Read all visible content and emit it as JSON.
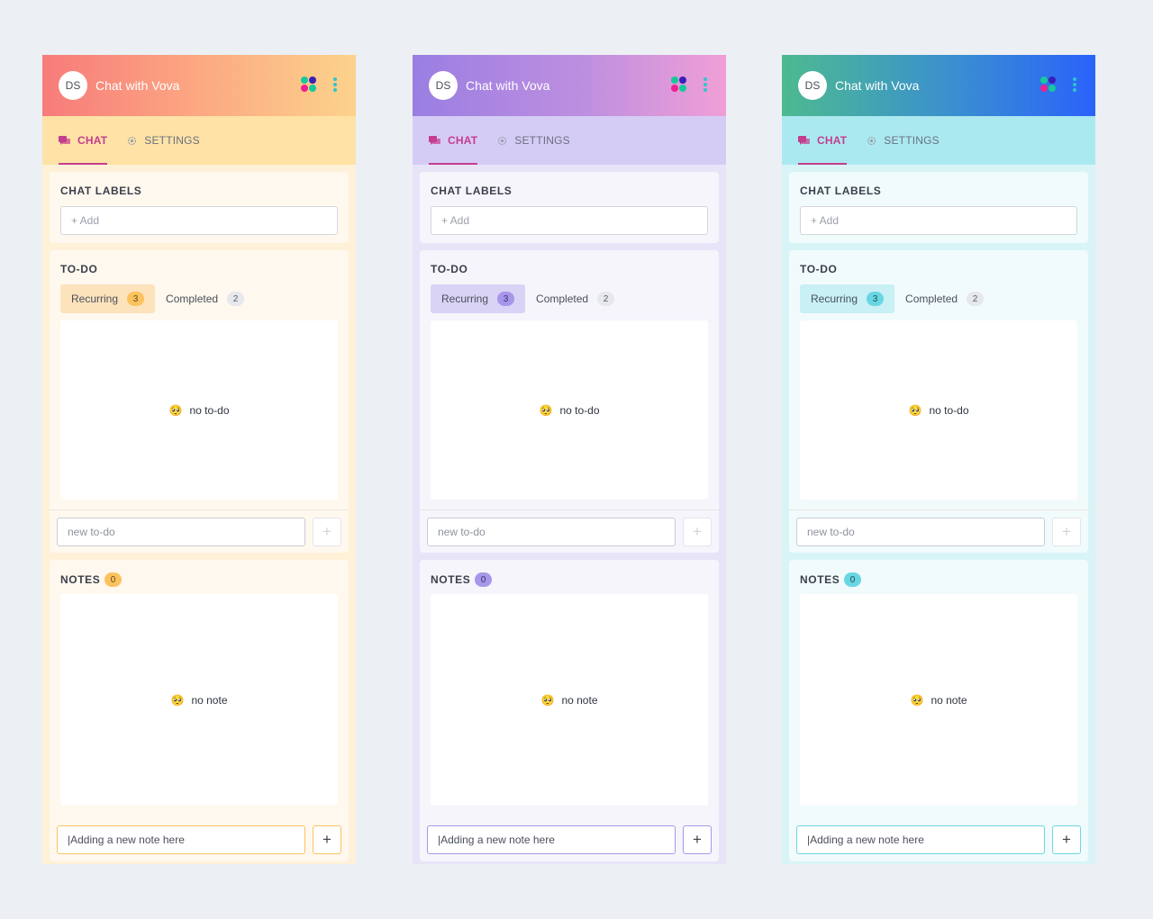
{
  "panels": [
    {
      "theme": "orange",
      "avatar": "DS",
      "title": "Chat with Vova",
      "tabs": {
        "chat": "CHAT",
        "settings": "SETTINGS"
      },
      "chat_labels": {
        "title": "CHAT LABELS",
        "add_placeholder": "+ Add"
      },
      "todo": {
        "title": "TO-DO",
        "recurring_label": "Recurring",
        "recurring_count": "3",
        "completed_label": "Completed",
        "completed_count": "2",
        "empty_emoji": "🥺",
        "empty_text": "no to-do",
        "new_placeholder": "new to-do",
        "add_button": "+"
      },
      "notes": {
        "title": "NOTES",
        "count": "0",
        "empty_emoji": "🥺",
        "empty_text": "no note",
        "new_value": "|Adding a new note here",
        "add_button": "+"
      }
    },
    {
      "theme": "purple",
      "avatar": "DS",
      "title": "Chat with Vova",
      "tabs": {
        "chat": "CHAT",
        "settings": "SETTINGS"
      },
      "chat_labels": {
        "title": "CHAT LABELS",
        "add_placeholder": "+ Add"
      },
      "todo": {
        "title": "TO-DO",
        "recurring_label": "Recurring",
        "recurring_count": "3",
        "completed_label": "Completed",
        "completed_count": "2",
        "empty_emoji": "🥺",
        "empty_text": "no to-do",
        "new_placeholder": "new to-do",
        "add_button": "+"
      },
      "notes": {
        "title": "NOTES",
        "count": "0",
        "empty_emoji": "🥺",
        "empty_text": "no note",
        "new_value": "|Adding a new note here",
        "add_button": "+"
      }
    },
    {
      "theme": "teal",
      "avatar": "DS",
      "title": "Chat with Vova",
      "tabs": {
        "chat": "CHAT",
        "settings": "SETTINGS"
      },
      "chat_labels": {
        "title": "CHAT LABELS",
        "add_placeholder": "+ Add"
      },
      "todo": {
        "title": "TO-DO",
        "recurring_label": "Recurring",
        "recurring_count": "3",
        "completed_label": "Completed",
        "completed_count": "2",
        "empty_emoji": "🥺",
        "empty_text": "no to-do",
        "new_placeholder": "new to-do",
        "add_button": "+"
      },
      "notes": {
        "title": "NOTES",
        "count": "0",
        "empty_emoji": "🥺",
        "empty_text": "no note",
        "new_value": "|Adding a new note here",
        "add_button": "+"
      }
    }
  ],
  "colors": {
    "accent_tab": "#c43d8f",
    "orange_header": [
      "#f77b7b",
      "#fcd38c"
    ],
    "purple_header": [
      "#9a7ee2",
      "#f09fd6"
    ],
    "teal_header": [
      "#4dba90",
      "#2a62fb"
    ]
  },
  "icons": {
    "app_switcher": "four-dots-icon",
    "more": "kebab-menu-icon",
    "chat_tab": "chat-bubbles-icon",
    "settings_tab": "gear-icon"
  }
}
